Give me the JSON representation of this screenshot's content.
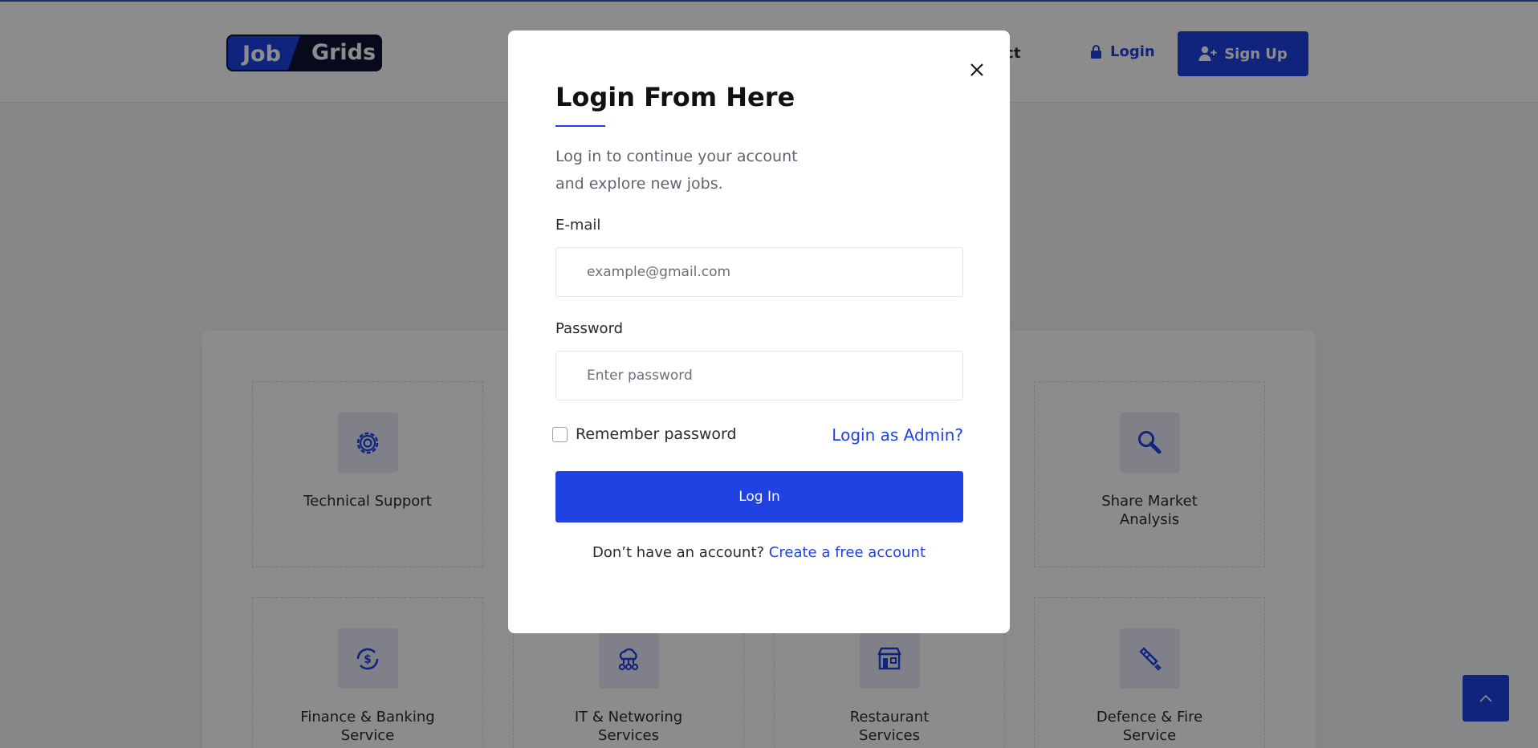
{
  "header": {
    "logo_part1": "Job",
    "logo_part2": "Grids",
    "nav_contact": "act",
    "login_label": "Login",
    "signup_label": "Sign Up"
  },
  "categories": [
    {
      "label": "Technical Support",
      "icon": "gear-icon"
    },
    {
      "label": "Share Market Analysis",
      "icon": "magnifier-icon"
    },
    {
      "label": "Finance & Banking Service",
      "icon": "currency-exchange-icon"
    },
    {
      "label": "IT & Networing Services",
      "icon": "network-cloud-icon"
    },
    {
      "label": "Restaurant Services",
      "icon": "storefront-icon"
    },
    {
      "label": "Defence & Fire Service",
      "icon": "fire-extinguisher-icon"
    }
  ],
  "modal": {
    "title": "Login From Here",
    "subtitle": "Log in to continue your account and explore new jobs.",
    "email_label": "E-mail",
    "email_placeholder": "example@gmail.com",
    "password_label": "Password",
    "password_placeholder": "Enter password",
    "remember_label": "Remember password",
    "admin_link": "Login as Admin?",
    "login_button": "Log In",
    "no_account_text": "Don’t have an account?",
    "create_account_link": "Create a free account"
  },
  "colors": {
    "accent": "#2042e3",
    "logo_dark": "#0d1333",
    "overlay": "rgba(0,0,0,0.45)"
  }
}
